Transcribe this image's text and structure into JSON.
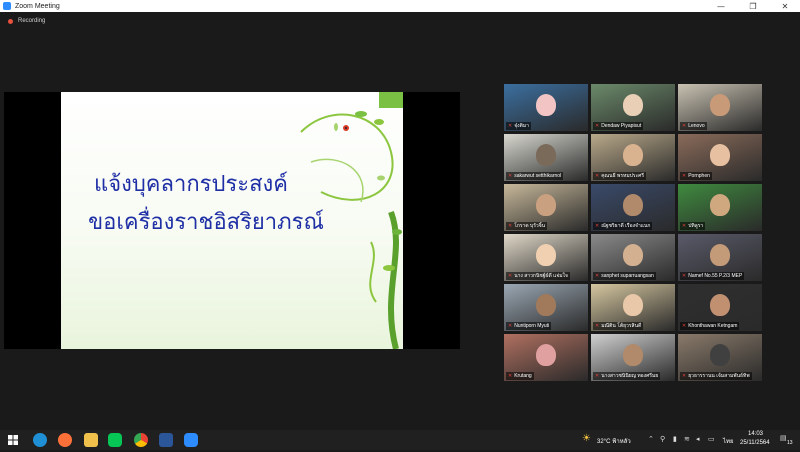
{
  "window": {
    "title": "Zoom Meeting",
    "minimize": "—",
    "maximize": "❐",
    "close": "✕"
  },
  "recording": {
    "label": "Recording"
  },
  "slide": {
    "line1": "แจ้งบุคลากรประสงค์",
    "line2": "ขอเครื่องราชอิสริยาภรณ์"
  },
  "participants": [
    {
      "name": "จุ๋งติมา",
      "active": true
    },
    {
      "name": "Dendaw Piyapisut",
      "active": false
    },
    {
      "name": "Lenovo",
      "active": false
    },
    {
      "name": "sakarwut setthikarnol",
      "active": false
    },
    {
      "name": "คุณนธี พรหมประศรี",
      "active": false
    },
    {
      "name": "Pornphen",
      "active": false
    },
    {
      "name": "โกราด บุรัวจิ้น",
      "active": false
    },
    {
      "name": "ณัฐชริธาดี เรืองจำแนก",
      "active": false
    },
    {
      "name": "ปทิลูรา",
      "active": false
    },
    {
      "name": "นาง สาวกนิชฐ์ผ์ดี แจ่มใจ",
      "active": false
    },
    {
      "name": "sanphet suparruangsan",
      "active": false
    },
    {
      "name": "Namef No.55 P.2/3 MEP",
      "active": false
    },
    {
      "name": "Nuntiporn Myuti",
      "active": false
    },
    {
      "name": "มณีติน โต้ยุวรสินดี",
      "active": false
    },
    {
      "name": "Khonthawan Ketngam",
      "active": false
    },
    {
      "name": "Krutang",
      "active": false
    },
    {
      "name": "นางสาวชนินิยญ ทองศรีมย",
      "active": false
    },
    {
      "name": "ยุวธารรานน เจ้มสามพันธ์ทิพ",
      "active": false
    }
  ],
  "taskbar": {
    "weather": "32°C ฟ้าหลัว",
    "language": "ไทย",
    "time": "14:03",
    "date": "25/11/2564",
    "notifications": "13"
  },
  "colors": {
    "accent": "#2d8cff",
    "speaker_border": "#e9e341",
    "muted": "#e0403a",
    "slide_text": "#1f2fa6"
  }
}
